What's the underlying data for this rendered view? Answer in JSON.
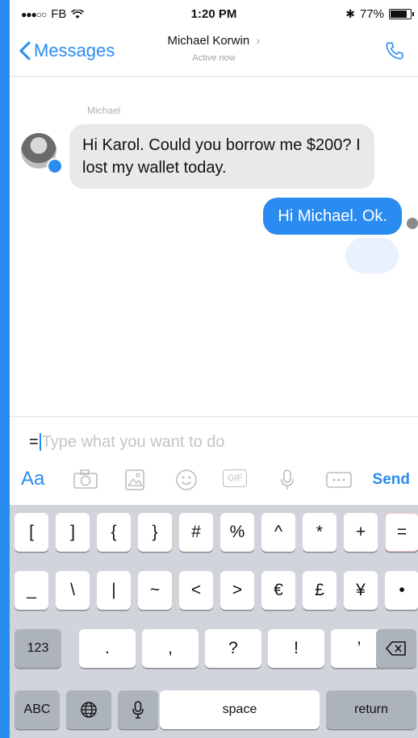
{
  "status_bar": {
    "carrier": "FB",
    "time": "1:20 PM",
    "battery": "77%",
    "battery_level": 0.77
  },
  "nav": {
    "back_label": "Messages",
    "contact_name": "Michael Korwin",
    "presence": "Active now"
  },
  "conversation": {
    "sender_label": "Michael",
    "incoming_message": "Hi Karol. Could you borrow me $200? I lost my wallet today.",
    "outgoing_message": "Hi Michael. Ok."
  },
  "composer": {
    "prefix": "=",
    "placeholder": "Type what you want to do",
    "aa_label": "Aa",
    "send_label": "Send",
    "gif_label": "GIF"
  },
  "keyboard": {
    "row1": [
      "[",
      "]",
      "{",
      "}",
      "#",
      "%",
      "^",
      "*",
      "+",
      "="
    ],
    "row2": [
      "_",
      "\\",
      "|",
      "~",
      "<",
      ">",
      "€",
      "£",
      "¥",
      "•"
    ],
    "row3": [
      ".",
      ",",
      "?",
      "!",
      "’"
    ],
    "numbers_label": "123",
    "abc_label": "ABC",
    "space_label": "space",
    "return_label": "return"
  },
  "colors": {
    "accent": "#2a8cf0",
    "incoming_bubble": "#e9e9eb",
    "keyboard_bg": "#d1d4da"
  }
}
